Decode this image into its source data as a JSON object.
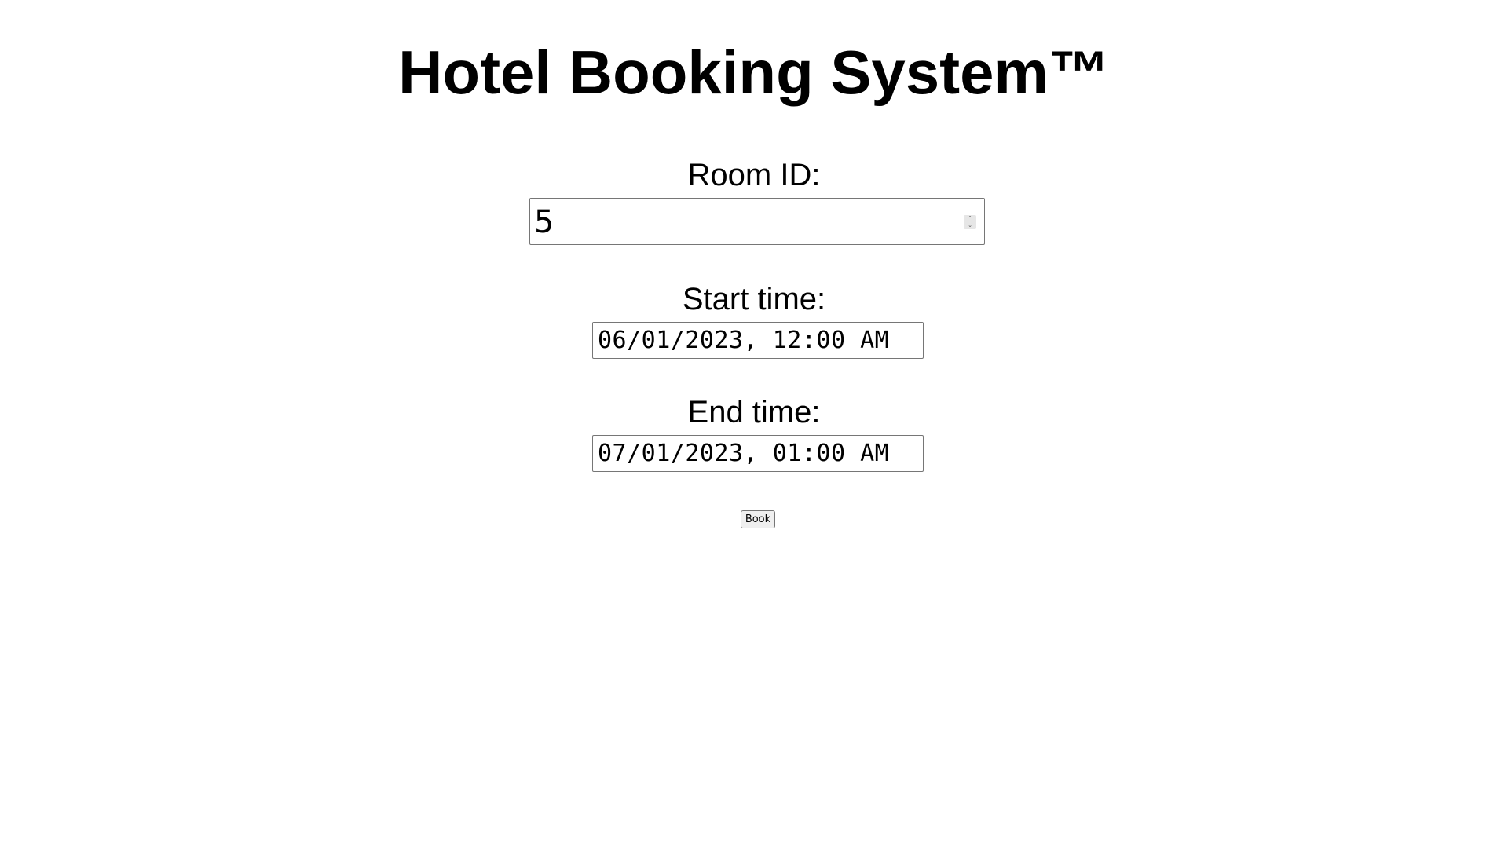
{
  "header": {
    "title": "Hotel Booking System™"
  },
  "form": {
    "room_id": {
      "label": "Room ID:",
      "value": "5"
    },
    "start_time": {
      "label": "Start time:",
      "value": "06/01/2023, 12:00 AM"
    },
    "end_time": {
      "label": "End time:",
      "value": "07/01/2023, 01:00 AM"
    },
    "book_button_label": "Book"
  },
  "icons": {
    "spinner_up": "chevron-up-icon",
    "spinner_down": "chevron-down-icon"
  }
}
